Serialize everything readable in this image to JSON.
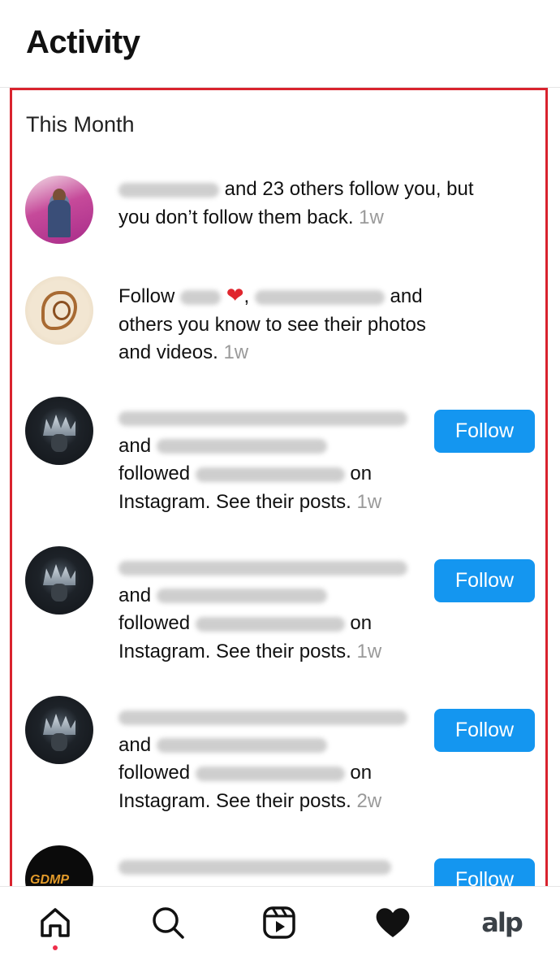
{
  "header": {
    "title": "Activity"
  },
  "section": {
    "title": "This Month"
  },
  "notifications": [
    {
      "line1_suffix": " and 23 others follow you, but",
      "line2": "you don’t follow them back.",
      "time": "1w"
    },
    {
      "line1_prefix": "Follow",
      "line1_sep": ",",
      "line1_suffix": "and",
      "line2": "others you know to see their photos",
      "line3": "and videos.",
      "time": "1w"
    },
    {
      "line2": "and",
      "line3_prefix": "followed",
      "line3_suffix": "on",
      "line4": "Instagram. See their posts.",
      "time": "1w",
      "button": "Follow"
    },
    {
      "line2": "and",
      "line3_prefix": "followed",
      "line3_suffix": "on",
      "line4": "Instagram. See their posts.",
      "time": "1w",
      "button": "Follow"
    },
    {
      "line2": "and",
      "line3_prefix": "followed",
      "line3_suffix": "on",
      "line4": "Instagram. See their posts.",
      "time": "2w",
      "button": "Follow"
    },
    {
      "avatar_text": "GDMP",
      "button": "Follow"
    }
  ],
  "tabbar": {
    "items": [
      "home-icon",
      "search-icon",
      "reels-icon",
      "heart-icon",
      "profile-avatar"
    ],
    "profile_text": "alp"
  },
  "colors": {
    "accent": "#1496f0",
    "highlight": "#d9232e",
    "notification_dot": "#ee2d4a"
  }
}
